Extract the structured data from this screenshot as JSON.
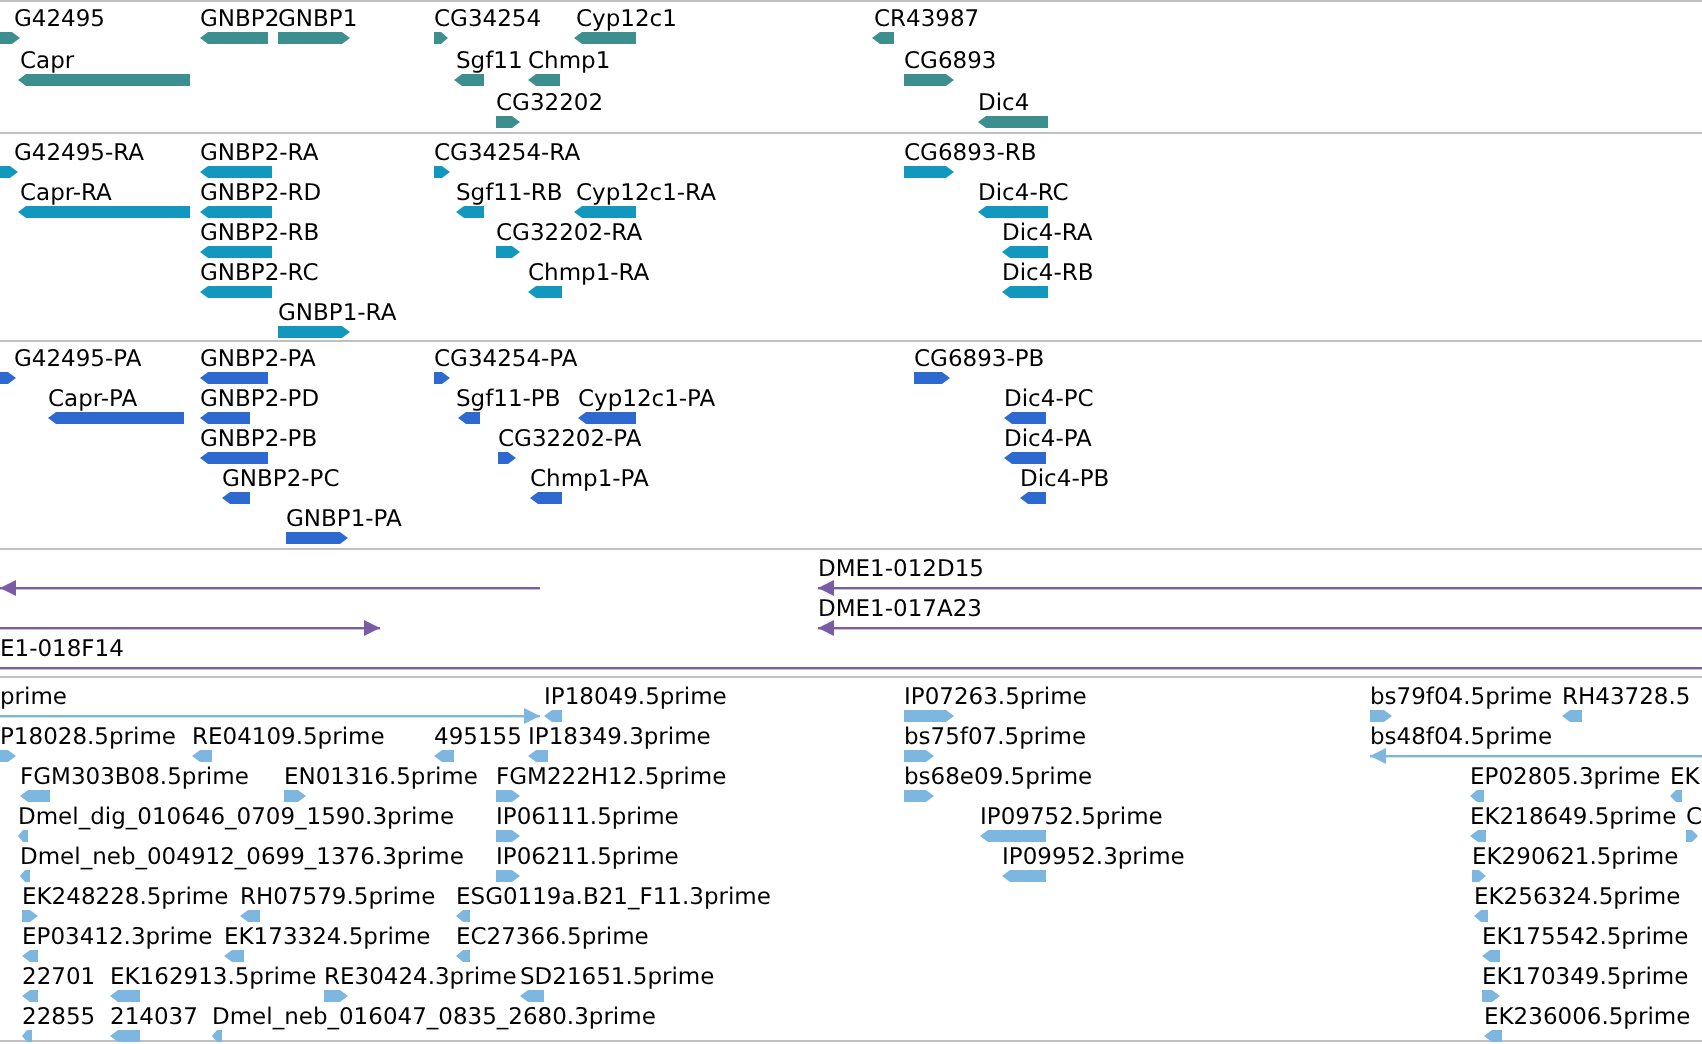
{
  "tracks": [
    {
      "kind": "gene",
      "features": [
        {
          "label": "G42495",
          "reverse": false
        },
        {
          "label": "Capr",
          "reverse": true
        },
        {
          "label": "GNBP2",
          "reverse": true
        },
        {
          "label": "GNBP1",
          "reverse": false
        },
        {
          "label": "CG34254",
          "reverse": false
        },
        {
          "label": "Cyp12c1",
          "reverse": true
        },
        {
          "label": "Sgf11",
          "reverse": true
        },
        {
          "label": "Chmp1",
          "reverse": true
        },
        {
          "label": "CG32202",
          "reverse": false
        },
        {
          "label": "CR43987",
          "reverse": true
        },
        {
          "label": "CG6893",
          "reverse": false
        },
        {
          "label": "Dic4",
          "reverse": true
        }
      ]
    },
    {
      "kind": "mrna",
      "features": [
        {
          "label": "G42495-RA",
          "reverse": false
        },
        {
          "label": "Capr-RA",
          "reverse": true
        },
        {
          "label": "GNBP2-RA",
          "reverse": true
        },
        {
          "label": "GNBP2-RD",
          "reverse": true
        },
        {
          "label": "GNBP2-RB",
          "reverse": true
        },
        {
          "label": "GNBP2-RC",
          "reverse": true
        },
        {
          "label": "GNBP1-RA",
          "reverse": false
        },
        {
          "label": "CG34254-RA",
          "reverse": false
        },
        {
          "label": "Sgf11-RB",
          "reverse": true
        },
        {
          "label": "Cyp12c1-RA",
          "reverse": true
        },
        {
          "label": "CG32202-RA",
          "reverse": false
        },
        {
          "label": "Chmp1-RA",
          "reverse": true
        },
        {
          "label": "CG6893-RB",
          "reverse": false
        },
        {
          "label": "Dic4-RC",
          "reverse": true
        },
        {
          "label": "Dic4-RA",
          "reverse": true
        },
        {
          "label": "Dic4-RB",
          "reverse": true
        }
      ]
    },
    {
      "kind": "protein",
      "features": [
        {
          "label": "G42495-PA",
          "reverse": false
        },
        {
          "label": "Capr-PA",
          "reverse": true
        },
        {
          "label": "GNBP2-PA",
          "reverse": true
        },
        {
          "label": "GNBP2-PD",
          "reverse": true
        },
        {
          "label": "GNBP2-PB",
          "reverse": true
        },
        {
          "label": "GNBP2-PC",
          "reverse": true
        },
        {
          "label": "GNBP1-PA",
          "reverse": false
        },
        {
          "label": "CG34254-PA",
          "reverse": false
        },
        {
          "label": "Sgf11-PB",
          "reverse": true
        },
        {
          "label": "Cyp12c1-PA",
          "reverse": true
        },
        {
          "label": "CG32202-PA",
          "reverse": false
        },
        {
          "label": "Chmp1-PA",
          "reverse": true
        },
        {
          "label": "CG6893-PB",
          "reverse": false
        },
        {
          "label": "Dic4-PC",
          "reverse": true
        },
        {
          "label": "Dic4-PA",
          "reverse": true
        },
        {
          "label": "Dic4-PB",
          "reverse": true
        }
      ]
    },
    {
      "kind": "clone",
      "features": [
        {
          "reverse": true
        },
        {
          "label": "DME1-012D15",
          "reverse": true
        },
        {
          "label": "DME1-017A23",
          "reverse": true
        },
        {
          "reverse": false
        },
        {
          "label": "E1-018F14"
        }
      ]
    },
    {
      "kind": "est",
      "features": [
        {
          "label": "prime",
          "reverse": false
        },
        {
          "label": "IP18049.5prime",
          "reverse": true
        },
        {
          "label": "IP07263.5prime",
          "reverse": false
        },
        {
          "label": "bs79f04.5prime",
          "reverse": false
        },
        {
          "label": "RH43728.5",
          "reverse": true
        },
        {
          "label": "P18028.5prime",
          "reverse": false
        },
        {
          "label": "RE04109.5prime",
          "reverse": true
        },
        {
          "label": "495155",
          "reverse": true
        },
        {
          "label": "IP18349.3prime",
          "reverse": true
        },
        {
          "label": "bs75f07.5prime",
          "reverse": false
        },
        {
          "label": "bs48f04.5prime",
          "reverse": true
        },
        {
          "label": "FGM303B08.5prime",
          "reverse": true
        },
        {
          "label": "EN01316.5prime",
          "reverse": false
        },
        {
          "label": "FGM222H12.5prime",
          "reverse": false
        },
        {
          "label": "bs68e09.5prime",
          "reverse": false
        },
        {
          "label": "EP02805.3prime",
          "reverse": true
        },
        {
          "label": "EK",
          "reverse": true
        },
        {
          "label": "Dmel_dig_010646_0709_1590.3prime",
          "reverse": true
        },
        {
          "label": "IP06111.5prime",
          "reverse": false
        },
        {
          "label": "IP09752.5prime",
          "reverse": true
        },
        {
          "label": "EK218649.5prime",
          "reverse": true
        },
        {
          "label": "C",
          "reverse": false
        },
        {
          "label": "Dmel_neb_004912_0699_1376.3prime",
          "reverse": true
        },
        {
          "label": "IP06211.5prime",
          "reverse": false
        },
        {
          "label": "IP09952.3prime",
          "reverse": true
        },
        {
          "label": "EK290621.5prime",
          "reverse": false
        },
        {
          "label": "EK248228.5prime",
          "reverse": false
        },
        {
          "label": "RH07579.5prime",
          "reverse": true
        },
        {
          "label": "ESG0119a.B21_F11.3prime",
          "reverse": true
        },
        {
          "label": "EK256324.5prime",
          "reverse": true
        },
        {
          "label": "EP03412.3prime",
          "reverse": true
        },
        {
          "label": "EK173324.5prime",
          "reverse": true
        },
        {
          "label": "EC27366.5prime",
          "reverse": true
        },
        {
          "label": "EK175542.5prime",
          "reverse": true
        },
        {
          "label": "22701",
          "reverse": true
        },
        {
          "label": "EK162913.5prime",
          "reverse": true
        },
        {
          "label": "RE30424.3prime",
          "reverse": false
        },
        {
          "label": "SD21651.5prime",
          "reverse": true
        },
        {
          "label": "EK170349.5prime",
          "reverse": false
        },
        {
          "label": "22855",
          "reverse": true
        },
        {
          "label": "214037",
          "reverse": true
        },
        {
          "label": "Dmel_neb_016047_0835_2680.3prime",
          "reverse": true
        },
        {
          "label": "EK236006.5prime",
          "reverse": true
        }
      ]
    }
  ]
}
